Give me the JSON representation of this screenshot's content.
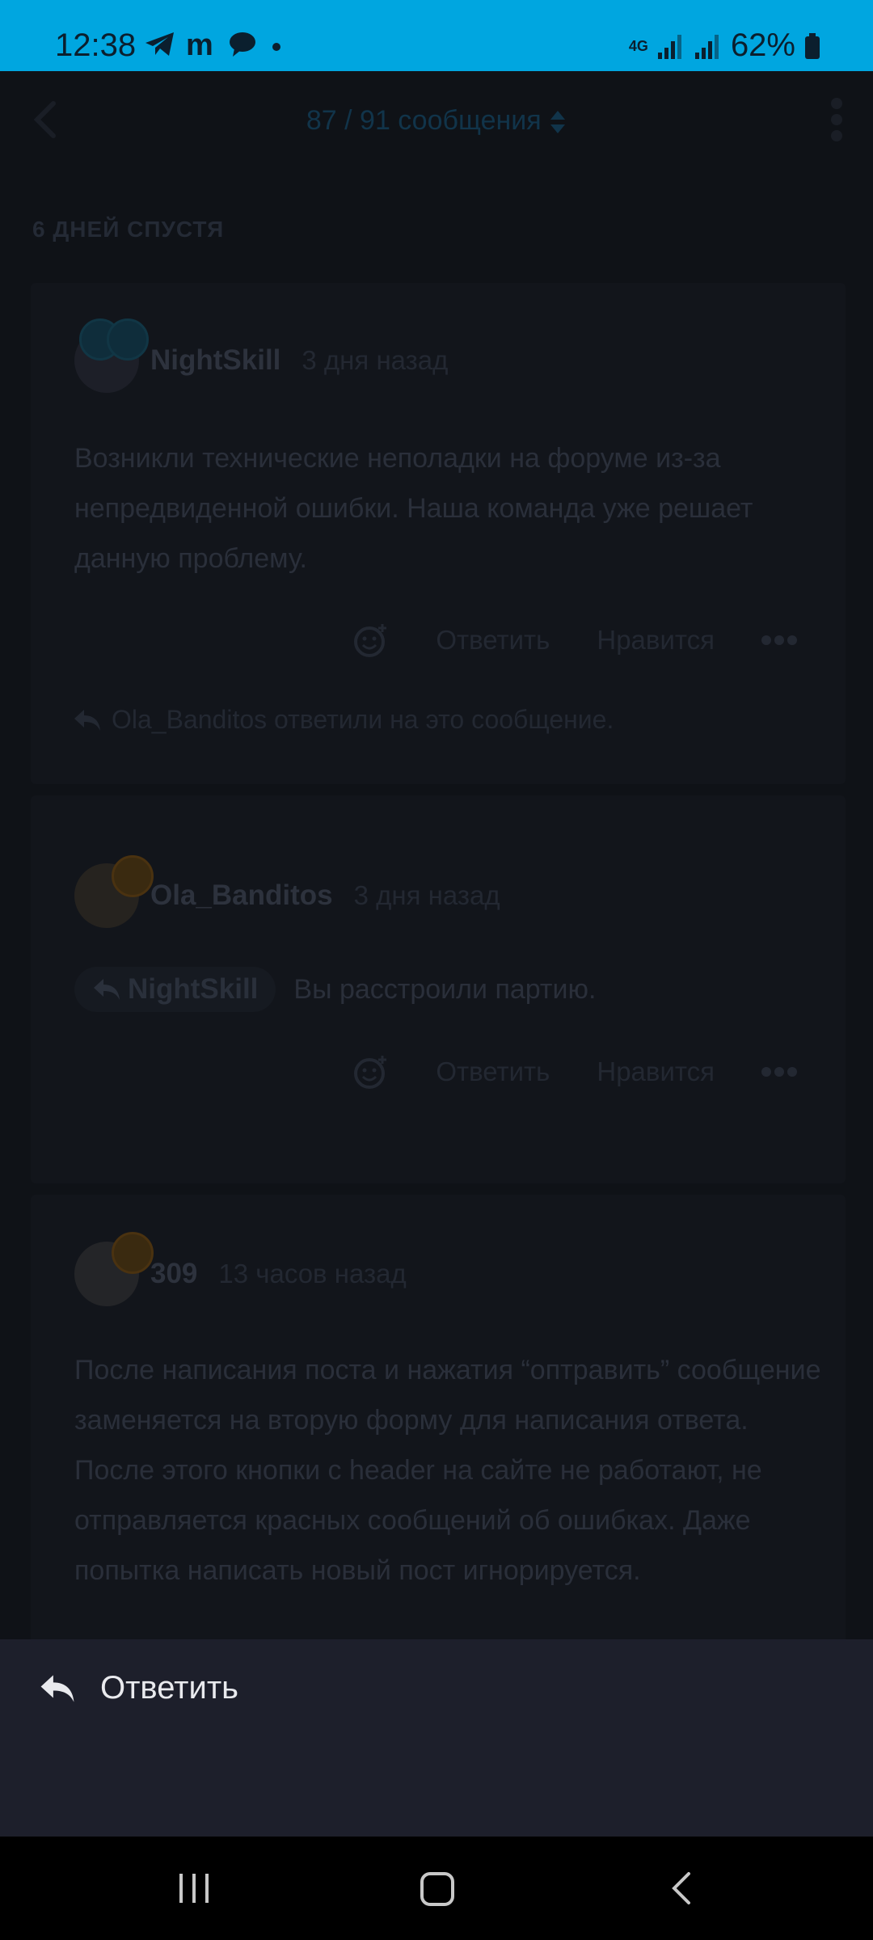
{
  "status": {
    "time": "12:38",
    "net": "4G",
    "battery": "62%"
  },
  "header": {
    "counter": "87 / 91 сообщения"
  },
  "separator": "6 ДНЕЙ СПУСТЯ",
  "posts": [
    {
      "username": "NightSkill",
      "time": "3 дня назад",
      "text": "Возникли технические неполадки на форуме из-за непредвиденной ошибки. Наша команда уже решает данную проблему.",
      "reply_label": "Ответить",
      "like_label": "Нравится",
      "reply_note": "Ola_Banditos ответили на это сообщение."
    },
    {
      "username": "Ola_Banditos",
      "time": "3 дня назад",
      "quote_user": "NightSkill",
      "text": "Вы расстроили партию.",
      "reply_label": "Ответить",
      "like_label": "Нравится"
    },
    {
      "username": "309",
      "time": "13 часов назад",
      "text": "После написания поста и нажатия “оптравить” сообщение заменяется на вторую форму для написания ответа. После этого кнопки с header на сайте не работают, не отправляется красных сообщений об ошибках. Даже попытка написать новый пост игнорируется."
    }
  ],
  "sheet": {
    "reply_label": "Ответить"
  }
}
